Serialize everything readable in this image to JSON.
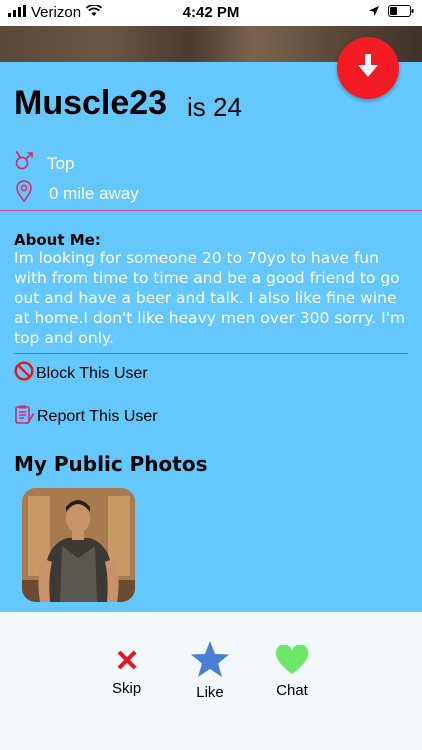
{
  "status_bar": {
    "carrier": "Verizon",
    "time": "4:42 PM"
  },
  "profile": {
    "name": "Muscle23",
    "age_text": "is 24",
    "role": "Top",
    "distance": "0 mile away",
    "about_heading": "About Me:",
    "about_text": "Im looking for someone 20 to 70yo to have fun with from time to time and be a good friend to go out and have a beer and talk. I also like fine wine at home.I don't like heavy men over 300 sorry. I'm top and only."
  },
  "actions": {
    "block": "Block This User",
    "report": "Report This User"
  },
  "photos": {
    "heading": "My Public Photos"
  },
  "bottom_bar": {
    "skip": "Skip",
    "like": "Like",
    "chat": "Chat"
  },
  "colors": {
    "background": "#64c8fc",
    "fab": "#f21b24",
    "divider": "#c2509a",
    "skip": "#e8141c",
    "like": "#4a7fd8",
    "chat": "#6de86a"
  }
}
